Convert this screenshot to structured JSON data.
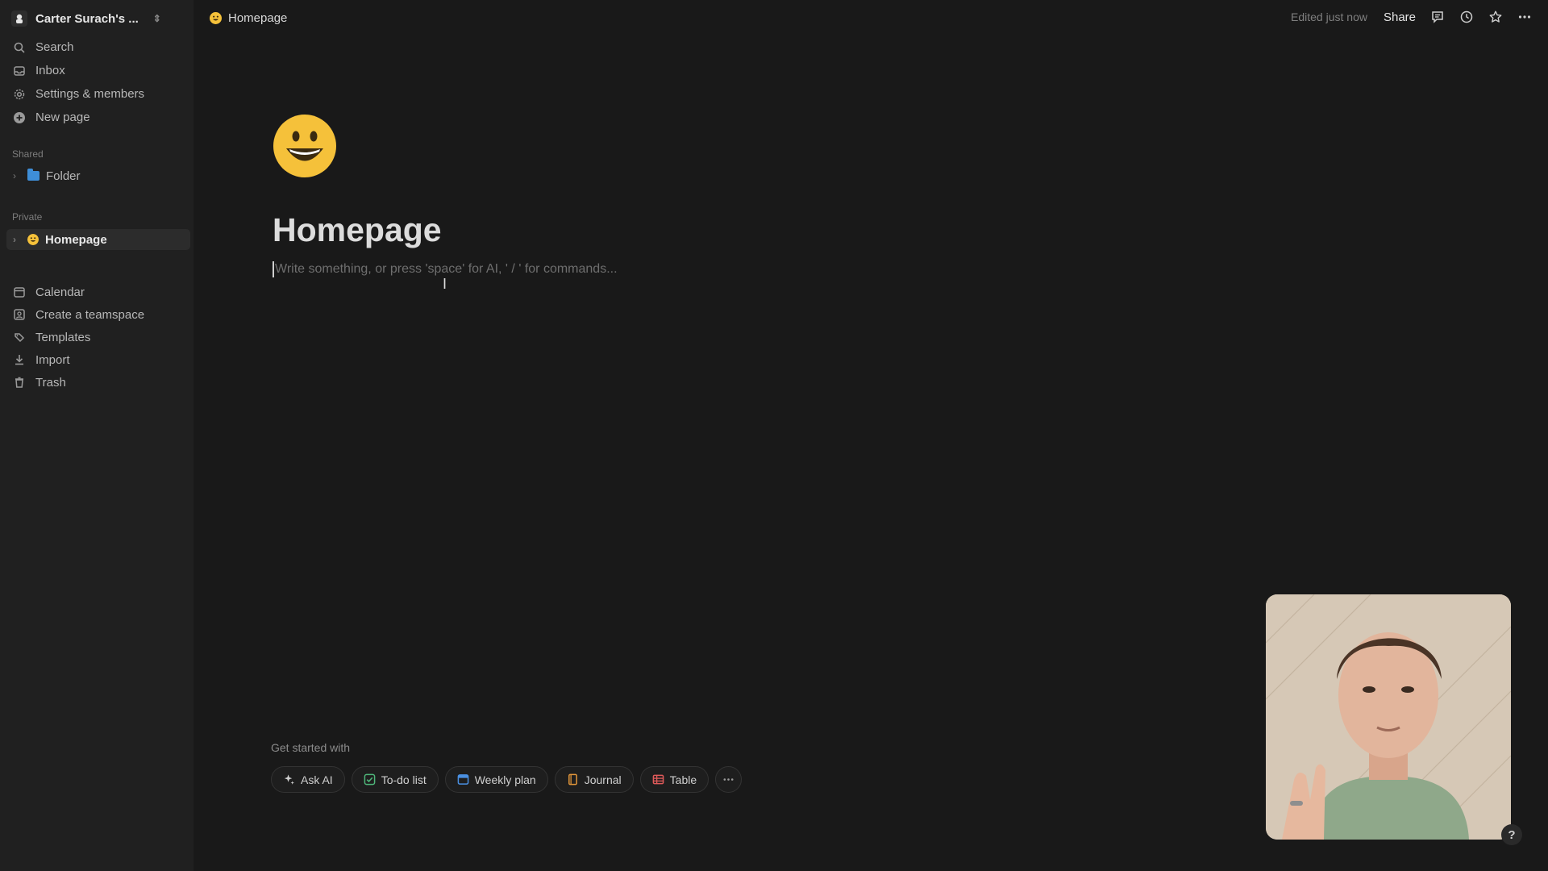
{
  "sidebar": {
    "workspace_name": "Carter Surach's ...",
    "nav": [
      {
        "label": "Search",
        "icon": "search-icon"
      },
      {
        "label": "Inbox",
        "icon": "inbox-icon"
      },
      {
        "label": "Settings & members",
        "icon": "gear-icon"
      },
      {
        "label": "New page",
        "icon": "plus-circle-icon"
      }
    ],
    "shared_label": "Shared",
    "shared_items": [
      {
        "label": "Folder",
        "icon": "folder-icon"
      }
    ],
    "private_label": "Private",
    "private_items": [
      {
        "label": "Homepage",
        "icon": "smiley-icon"
      }
    ],
    "bottom_nav": [
      {
        "label": "Calendar",
        "icon": "calendar-icon"
      },
      {
        "label": "Create a teamspace",
        "icon": "teamspace-icon"
      },
      {
        "label": "Templates",
        "icon": "templates-icon"
      },
      {
        "label": "Import",
        "icon": "import-icon"
      },
      {
        "label": "Trash",
        "icon": "trash-icon"
      }
    ]
  },
  "topbar": {
    "page_title": "Homepage",
    "edited_status": "Edited just now",
    "share_label": "Share"
  },
  "page": {
    "title": "Homepage",
    "placeholder": "Write something, or press 'space' for AI, ' / ' for commands..."
  },
  "get_started": {
    "label": "Get started with",
    "chips": [
      {
        "label": "Ask AI",
        "icon": "sparkle-icon"
      },
      {
        "label": "To-do list",
        "icon": "checkbox-icon"
      },
      {
        "label": "Weekly plan",
        "icon": "calendar-icon"
      },
      {
        "label": "Journal",
        "icon": "book-icon"
      },
      {
        "label": "Table",
        "icon": "table-icon"
      }
    ]
  },
  "help_label": "?",
  "colors": {
    "background": "#191919",
    "sidebar": "#202020",
    "accent_folder": "#3e8ed8",
    "emoji_yellow": "#f5c13a"
  }
}
